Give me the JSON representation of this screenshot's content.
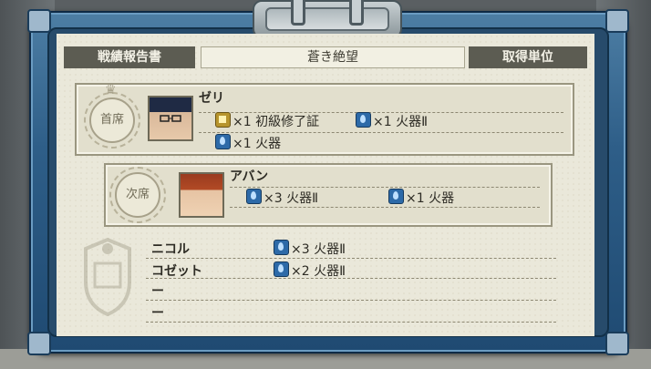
{
  "report": {
    "title_left": "戦績報告書",
    "title_center": "蒼き絶望",
    "title_right": "取得単位"
  },
  "ranks": [
    {
      "badge": "首席",
      "name": "ゼリ",
      "items": [
        {
          "icon": "gold-certificate-icon",
          "qty": "×1",
          "label": "初級修了証"
        },
        {
          "icon": "blue-fire-icon",
          "qty": "×1",
          "label": "火器Ⅱ"
        },
        {
          "icon": "blue-fire-icon",
          "qty": "×1",
          "label": "火器"
        }
      ]
    },
    {
      "badge": "次席",
      "name": "アバン",
      "items": [
        {
          "icon": "blue-fire-icon",
          "qty": "×3",
          "label": "火器Ⅱ"
        },
        {
          "icon": "blue-fire-icon",
          "qty": "×1",
          "label": "火器"
        }
      ]
    }
  ],
  "others": [
    {
      "name": "ニコル",
      "qty": "×3",
      "label": "火器Ⅱ",
      "icon": "blue-fire-icon"
    },
    {
      "name": "コゼット",
      "qty": "×2",
      "label": "火器Ⅱ",
      "icon": "blue-fire-icon"
    },
    {
      "name": "ー"
    },
    {
      "name": "ー"
    }
  ],
  "colors": {
    "frame": "#2e5e88",
    "paper": "#eae8da",
    "header_dark": "#5c5c52",
    "icon_blue": "#2d6aa8",
    "icon_gold": "#b7942c"
  }
}
